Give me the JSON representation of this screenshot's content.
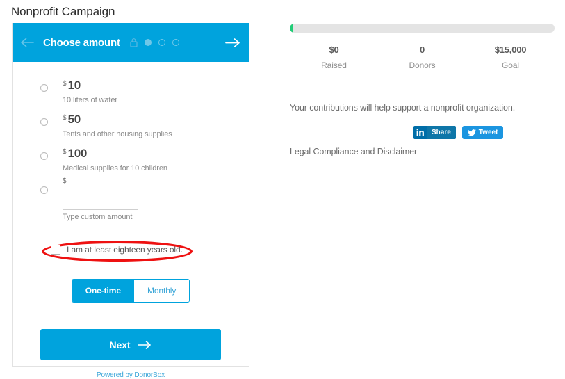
{
  "page": {
    "title": "Nonprofit Campaign"
  },
  "card": {
    "header": {
      "title": "Choose amount",
      "back_icon": "arrow-left-icon",
      "next_icon": "arrow-right-icon",
      "lock_icon": "lock-icon",
      "steps": [
        {
          "state": "filled"
        },
        {
          "state": "hollow"
        },
        {
          "state": "hollow"
        }
      ]
    },
    "amounts": [
      {
        "currency": "$",
        "value": "10",
        "description": "10 liters of water"
      },
      {
        "currency": "$",
        "value": "50",
        "description": "Tents and other housing supplies"
      },
      {
        "currency": "$",
        "value": "100",
        "description": "Medical supplies for 10 children"
      }
    ],
    "custom": {
      "currency": "$",
      "value": "",
      "placeholder": "",
      "description": "Type custom amount"
    },
    "age_confirm": {
      "label": "I am at least eighteen years old.",
      "checked": false
    },
    "frequency": {
      "one_time": "One-time",
      "monthly": "Monthly",
      "selected": "One-time"
    },
    "next_button": {
      "label": "Next",
      "icon": "arrow-right-icon"
    },
    "powered_by": "Powered by DonorBox"
  },
  "right": {
    "progress": {
      "percent": 1,
      "fill_color": "#22cc77",
      "track_color": "#e4e4e4"
    },
    "stats": [
      {
        "value": "$0",
        "label": "Raised"
      },
      {
        "value": "0",
        "label": "Donors"
      },
      {
        "value": "$15,000",
        "label": "Goal"
      }
    ],
    "contribution_text": "Your contributions will help support a nonprofit organization.",
    "share": {
      "linkedin_icon": "linkedin-icon",
      "linkedin_label": "Share",
      "twitter_icon": "twitter-bird-icon",
      "twitter_label": "Tweet"
    },
    "legal_text": "Legal Compliance and Disclaimer"
  },
  "colors": {
    "accent": "#00a3dd",
    "highlight": "#ee1111",
    "progress": "#22cc77"
  }
}
